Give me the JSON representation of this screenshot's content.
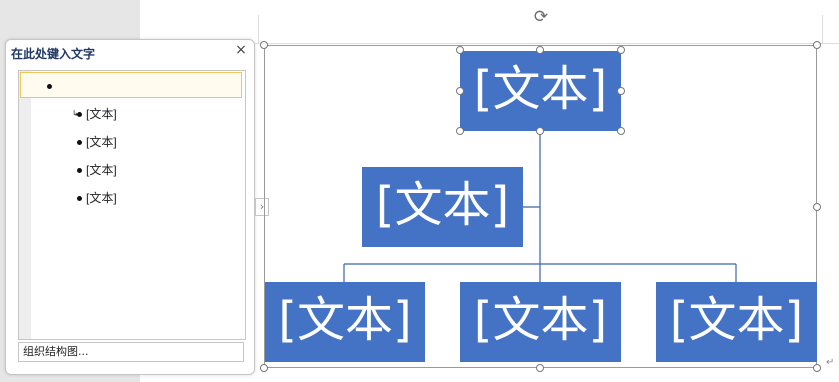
{
  "text_pane": {
    "title": "在此处键入文字",
    "close_label": "×",
    "items": [
      {
        "text": ""
      },
      {
        "text": "[文本]"
      },
      {
        "text": "[文本]"
      },
      {
        "text": "[文本]"
      },
      {
        "text": "[文本]"
      }
    ],
    "org_chart_button": "组织结构图...",
    "expand_handle": "›"
  },
  "diagram": {
    "top_node": "[文本]",
    "assistant_node": "[文本]",
    "child_nodes": [
      "[文本]",
      "[文本]",
      "[文本]"
    ],
    "rotate_icon": "⟳",
    "return_mark": "↵",
    "fill_color": "#4472c4",
    "line_color": "#3c65a8"
  }
}
